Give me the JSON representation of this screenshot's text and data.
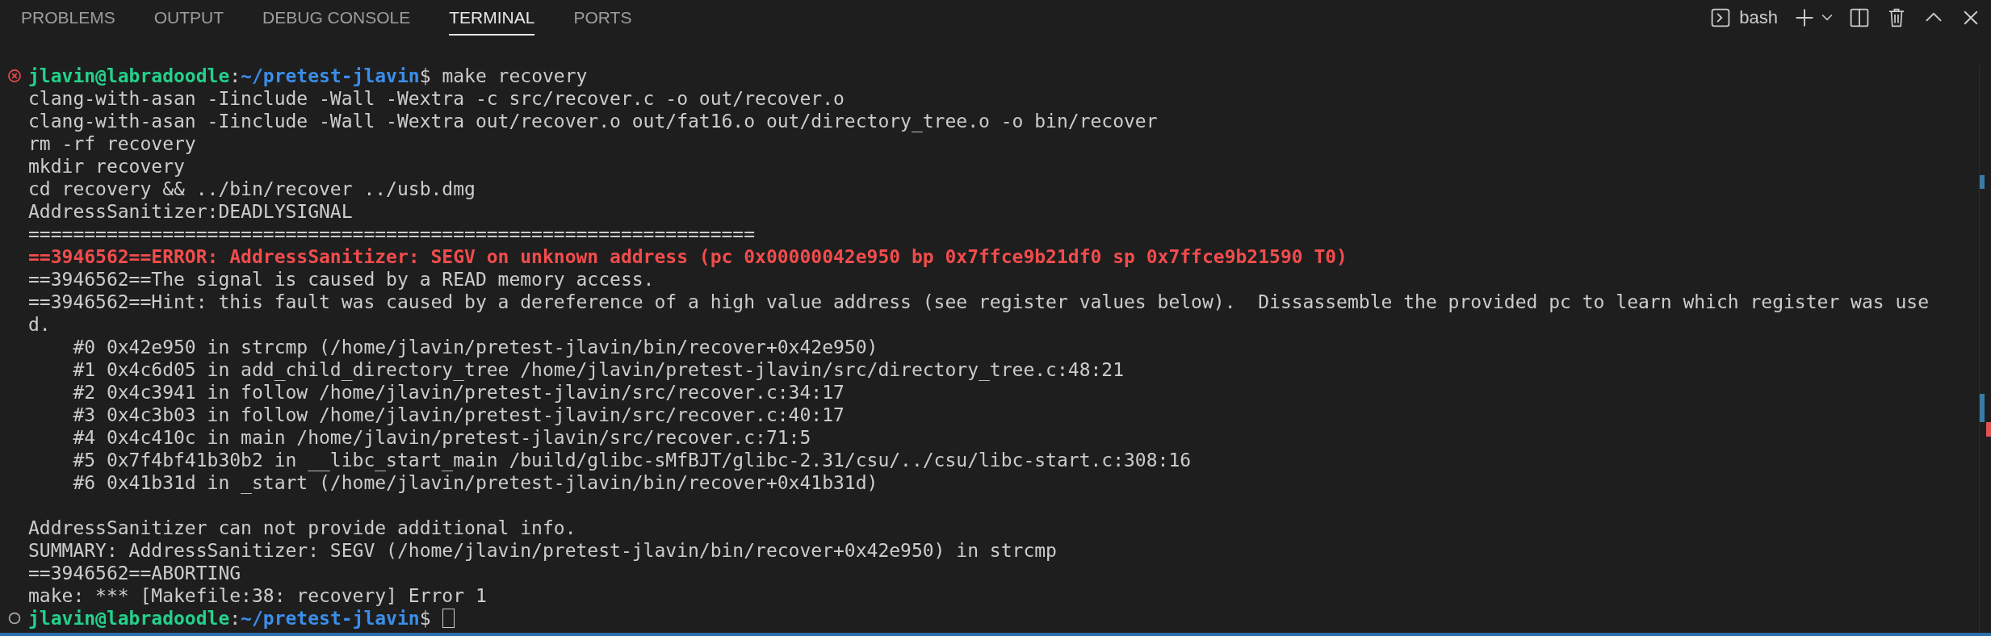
{
  "panel_tabs": [
    {
      "label": "PROBLEMS",
      "selected": false
    },
    {
      "label": "OUTPUT",
      "selected": false
    },
    {
      "label": "DEBUG CONSOLE",
      "selected": false
    },
    {
      "label": "TERMINAL",
      "selected": true
    },
    {
      "label": "PORTS",
      "selected": false
    }
  ],
  "terminal_selector": {
    "label": "bash"
  },
  "terminal_lines": [
    {
      "kind": "prompt",
      "error": true,
      "user": "jlavin@labradoodle",
      "separator": ":",
      "path": "~/pretest-jlavin",
      "symbol": "$",
      "command": " make recovery"
    },
    {
      "kind": "plain",
      "text": "clang-with-asan -Iinclude -Wall -Wextra -c src/recover.c -o out/recover.o"
    },
    {
      "kind": "plain",
      "text": "clang-with-asan -Iinclude -Wall -Wextra out/recover.o out/fat16.o out/directory_tree.o -o bin/recover"
    },
    {
      "kind": "plain",
      "text": "rm -rf recovery"
    },
    {
      "kind": "plain",
      "text": "mkdir recovery"
    },
    {
      "kind": "plain",
      "text": "cd recovery && ../bin/recover ../usb.dmg"
    },
    {
      "kind": "plain",
      "text": "AddressSanitizer:DEADLYSIGNAL"
    },
    {
      "kind": "plain",
      "text": "================================================================="
    },
    {
      "kind": "error",
      "text": "==3946562==ERROR: AddressSanitizer: SEGV on unknown address (pc 0x00000042e950 bp 0x7ffce9b21df0 sp 0x7ffce9b21590 T0)"
    },
    {
      "kind": "plain",
      "text": "==3946562==The signal is caused by a READ memory access."
    },
    {
      "kind": "plain",
      "text": "==3946562==Hint: this fault was caused by a dereference of a high value address (see register values below).  Dissassemble the provided pc to learn which register was use"
    },
    {
      "kind": "plain",
      "text": "d."
    },
    {
      "kind": "plain",
      "text": "    #0 0x42e950 in strcmp (/home/jlavin/pretest-jlavin/bin/recover+0x42e950)"
    },
    {
      "kind": "plain",
      "text": "    #1 0x4c6d05 in add_child_directory_tree /home/jlavin/pretest-jlavin/src/directory_tree.c:48:21"
    },
    {
      "kind": "plain",
      "text": "    #2 0x4c3941 in follow /home/jlavin/pretest-jlavin/src/recover.c:34:17"
    },
    {
      "kind": "plain",
      "text": "    #3 0x4c3b03 in follow /home/jlavin/pretest-jlavin/src/recover.c:40:17"
    },
    {
      "kind": "plain",
      "text": "    #4 0x4c410c in main /home/jlavin/pretest-jlavin/src/recover.c:71:5"
    },
    {
      "kind": "plain",
      "text": "    #5 0x7f4bf41b30b2 in __libc_start_main /build/glibc-sMfBJT/glibc-2.31/csu/../csu/libc-start.c:308:16"
    },
    {
      "kind": "plain",
      "text": "    #6 0x41b31d in _start (/home/jlavin/pretest-jlavin/bin/recover+0x41b31d)"
    },
    {
      "kind": "blank"
    },
    {
      "kind": "plain",
      "text": "AddressSanitizer can not provide additional info."
    },
    {
      "kind": "plain",
      "text": "SUMMARY: AddressSanitizer: SEGV (/home/jlavin/pretest-jlavin/bin/recover+0x42e950) in strcmp"
    },
    {
      "kind": "plain",
      "text": "==3946562==ABORTING"
    },
    {
      "kind": "plain",
      "text": "make: *** [Makefile:38: recovery] Error 1"
    },
    {
      "kind": "prompt",
      "error": false,
      "user": "jlavin@labradoodle",
      "separator": ":",
      "path": "~/pretest-jlavin",
      "symbol": "$",
      "cursor": true
    }
  ]
}
